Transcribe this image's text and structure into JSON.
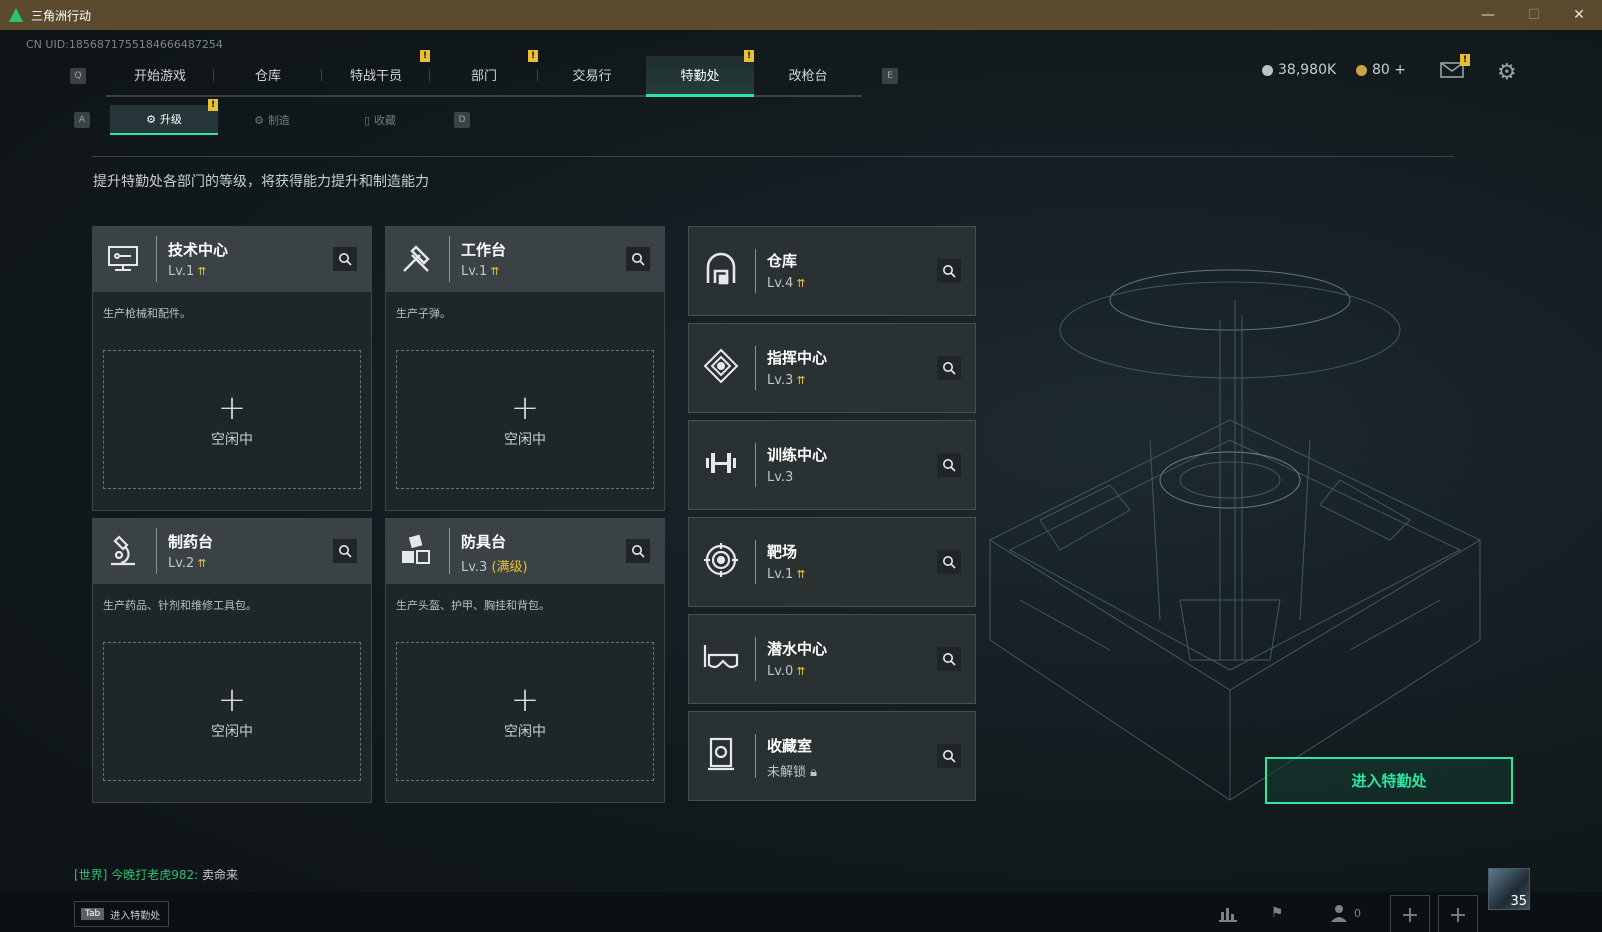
{
  "window": {
    "title": "三角洲行动",
    "controls": [
      "—",
      "☐",
      "✕"
    ]
  },
  "uid": "CN UID:1856871755184666487254",
  "nav": {
    "left_key": "Q",
    "right_key": "E",
    "tabs": [
      {
        "label": "开始游戏",
        "active": false,
        "alert": false
      },
      {
        "label": "仓库",
        "active": false,
        "alert": false
      },
      {
        "label": "特战干员",
        "active": false,
        "alert": true
      },
      {
        "label": "部门",
        "active": false,
        "alert": true
      },
      {
        "label": "交易行",
        "active": false,
        "alert": false
      },
      {
        "label": "特勤处",
        "active": true,
        "alert": true
      },
      {
        "label": "改枪台",
        "active": false,
        "alert": false
      }
    ]
  },
  "currency": {
    "coins": "38,980K",
    "bonds": "80 +"
  },
  "badge_mark": "!",
  "subnav": {
    "left_key": "A",
    "right_key": "D",
    "tabs": [
      {
        "label": "升级",
        "active": true
      },
      {
        "label": "制造",
        "active": false
      },
      {
        "label": "收藏",
        "active": false
      }
    ]
  },
  "instruction": "提升特勤处各部门的等级，将获得能力提升和制造能力",
  "production_stations": [
    {
      "name": "技术中心",
      "level": "Lv.1",
      "desc": "生产枪械和配件。",
      "slot": "空闲中",
      "icon": "computer-icon"
    },
    {
      "name": "工作台",
      "level": "Lv.1",
      "desc": "生产子弹。",
      "slot": "空闲中",
      "icon": "hammer-icon"
    },
    {
      "name": "制药台",
      "level": "Lv.2",
      "desc": "生产药品、针剂和维修工具包。",
      "slot": "空闲中",
      "icon": "microscope-icon"
    },
    {
      "name": "防具台",
      "level": "Lv.3",
      "level_note": "(满级)",
      "desc": "生产头盔、护甲、胸挂和背包。",
      "slot": "空闲中",
      "icon": "cubes-icon"
    }
  ],
  "facilities": [
    {
      "name": "仓库",
      "level": "Lv.4",
      "upgradable": true,
      "icon": "warehouse-icon"
    },
    {
      "name": "指挥中心",
      "level": "Lv.3",
      "upgradable": true,
      "icon": "command-icon"
    },
    {
      "name": "训练中心",
      "level": "Lv.3",
      "upgradable": false,
      "icon": "dumbbell-icon"
    },
    {
      "name": "靶场",
      "level": "Lv.1",
      "upgradable": true,
      "icon": "target-icon"
    },
    {
      "name": "潜水中心",
      "level": "Lv.0",
      "upgradable": true,
      "icon": "diving-mask-icon"
    },
    {
      "name": "收藏室",
      "level": "未解锁",
      "upgradable": false,
      "locked": true,
      "icon": "vault-icon"
    }
  ],
  "enter_button": "进入特勤处",
  "chat": {
    "channel": "[世界]",
    "user": "今晚打老虎982:",
    "message": "卖命来"
  },
  "bottom": {
    "tab_key": "Tab",
    "tab_hint": "进入特勤处",
    "friends_count": "0",
    "player_level": "35"
  },
  "colors": {
    "accent": "#2ee6a0",
    "alert": "#e8c037",
    "titlebar": "#5b4a2e"
  }
}
